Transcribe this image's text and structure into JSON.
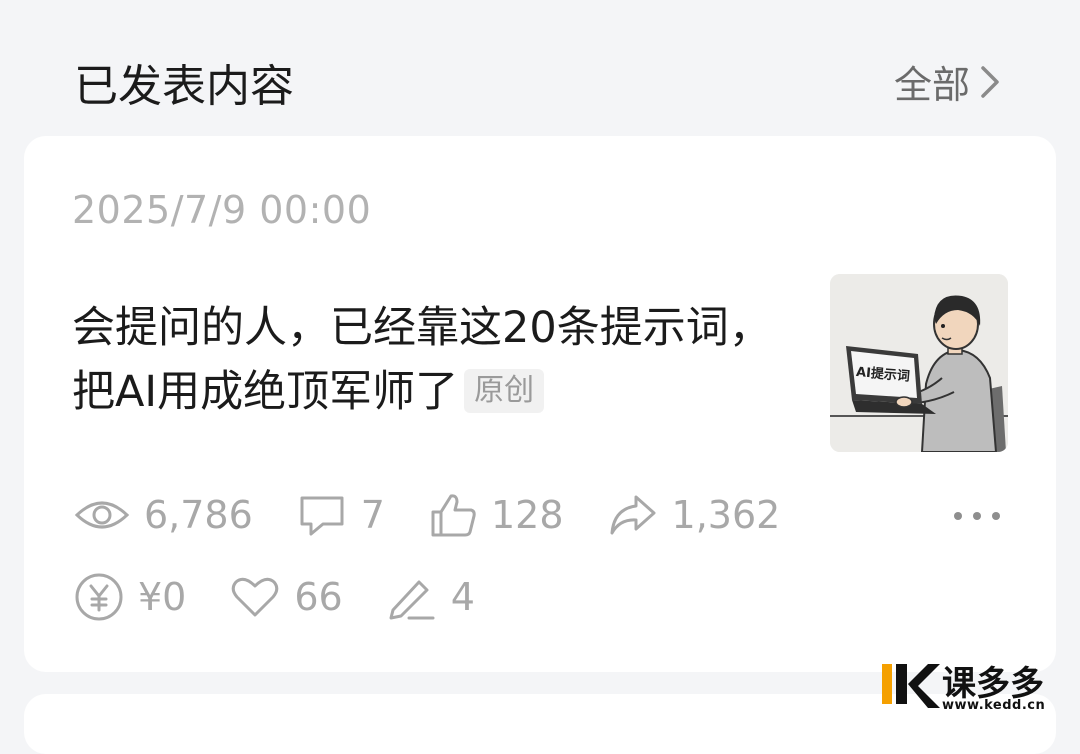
{
  "header": {
    "title": "已发表内容",
    "view_all_label": "全部"
  },
  "post": {
    "timestamp": "2025/7/9 00:00",
    "title": "会提问的人，已经靠这20条提示词，把AI用成绝顶军师了",
    "badge": "原创",
    "thumbnail_label": "AI提示词",
    "stats": {
      "views": "6,786",
      "comments": "7",
      "likes": "128",
      "shares": "1,362",
      "earnings": "¥0",
      "favorites": "66",
      "edits": "4"
    }
  },
  "watermark": {
    "brand": "课多多",
    "url": "www.kedd.cn"
  },
  "colors": {
    "background": "#f4f5f7",
    "card": "#ffffff",
    "primary_text": "#1b1b1b",
    "muted_text": "#a8a8a8",
    "watermark_orange": "#f5a000"
  },
  "icons": [
    "chevron-right-icon",
    "eye-icon",
    "comment-icon",
    "thumbs-up-icon",
    "share-icon",
    "yuan-icon",
    "heart-icon",
    "pencil-icon",
    "more-icon"
  ]
}
